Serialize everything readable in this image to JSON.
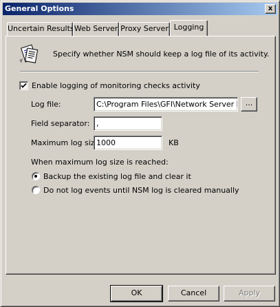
{
  "window": {
    "title": "General Options",
    "close_glyph": "x"
  },
  "tabs": [
    {
      "label": "Uncertain Results",
      "active": false
    },
    {
      "label": "Web Server",
      "active": false
    },
    {
      "label": "Proxy Server",
      "active": false
    },
    {
      "label": "Logging",
      "active": true
    }
  ],
  "logging": {
    "header_icon": "document-notes-icon",
    "description": "Specify whether NSM should keep a log file of its activity.",
    "enable_checkbox": {
      "label": "Enable logging of monitoring checks activity",
      "checked": true
    },
    "log_file": {
      "label": "Log file:",
      "value": "C:\\Program Files\\GFI\\Network Server Mon",
      "browse_label": "..."
    },
    "field_separator": {
      "label": "Field separator:",
      "value": ","
    },
    "max_log_size": {
      "label": "Maximum log size:",
      "value": "1000",
      "unit": "KB"
    },
    "when_max_reached_label": "When maximum log size is reached:",
    "options": [
      {
        "label": "Backup the existing log file and clear it",
        "selected": true
      },
      {
        "label": "Do not log events until NSM log is cleared manually",
        "selected": false
      }
    ]
  },
  "buttons": {
    "ok": "OK",
    "cancel": "Cancel",
    "apply": "Apply"
  }
}
